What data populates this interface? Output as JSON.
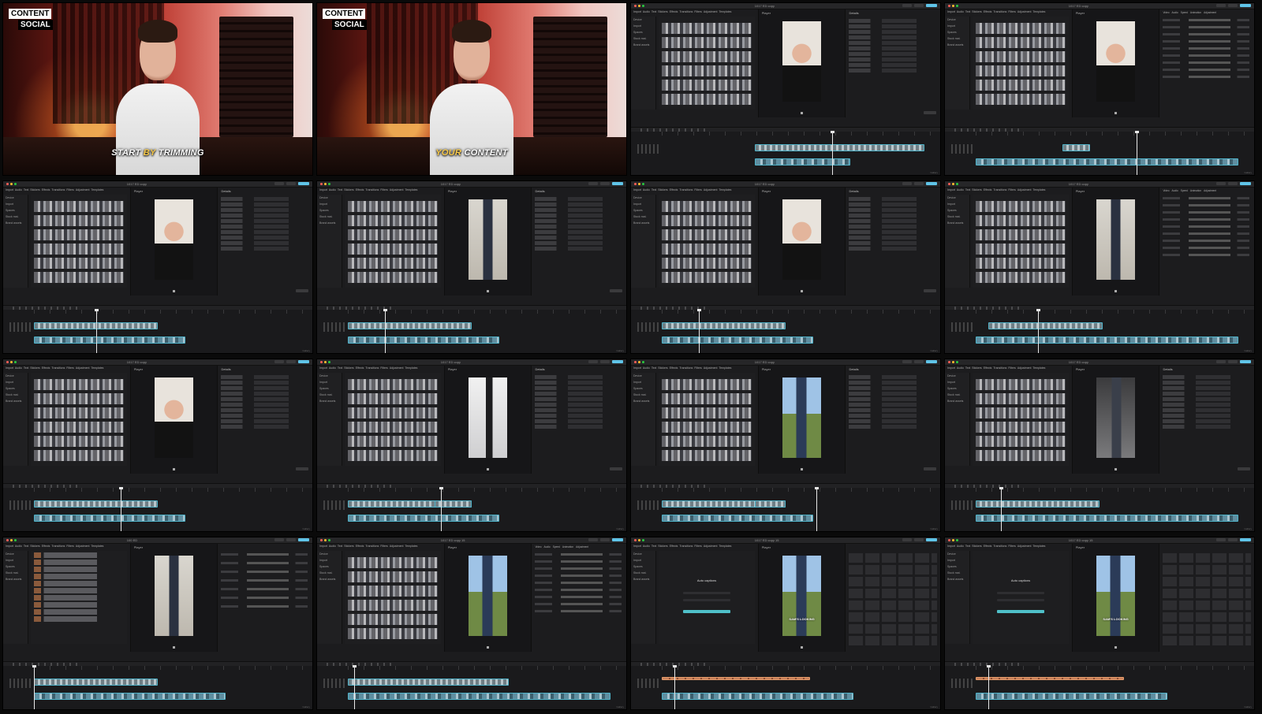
{
  "frames": [
    {
      "kind": "cam",
      "logo": [
        "CONTENT",
        "SOCIAL"
      ],
      "caption_pre": "START ",
      "caption_hl": "BY",
      "caption_post": " TRIMMING"
    },
    {
      "kind": "cam",
      "logo": [
        "CONTENT",
        "SOCIAL"
      ],
      "caption_pre": "",
      "caption_hl": "YOUR",
      "caption_post": " CONTENT"
    }
  ],
  "editor": {
    "project_name": "1017 ED copy",
    "project_name_alt": "100 ED",
    "project_name_copy": "1017 ED copy 15",
    "player_title": "Player",
    "details_title": "Details",
    "adjust_tabs": [
      "Video",
      "Audio",
      "Speed",
      "Animation",
      "Adjustment"
    ],
    "media_tabs": [
      "Import",
      "Audio",
      "Text",
      "Stickers",
      "Effects",
      "Transitions",
      "Filters",
      "Adjustment",
      "Templates"
    ],
    "side_nav": [
      "Device",
      "Import",
      "Spaces",
      "Stock mat.",
      "Brand assets"
    ],
    "auto_captions_title": "Auto captions",
    "video_caption": "SAM'S LOOKING"
  },
  "watermark": "Gallery"
}
